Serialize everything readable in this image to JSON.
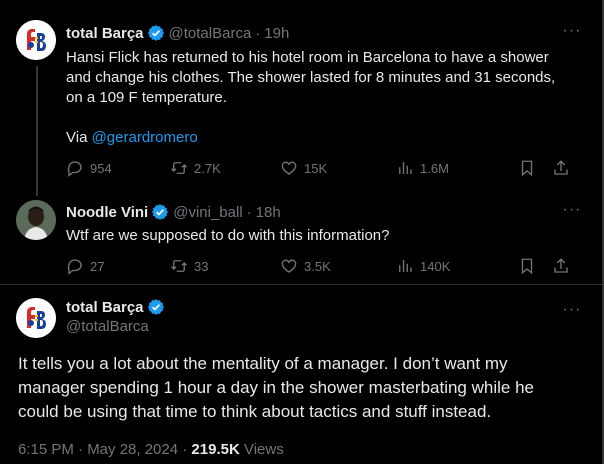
{
  "tweets": [
    {
      "name": "total Barça",
      "handle": "@totalBarca",
      "time": "19h",
      "text_lines": [
        "Hansi Flick has returned to his hotel room in Barcelona to have a shower",
        "and change his clothes. The shower lasted for 8 minutes and 31 seconds,",
        "on a 109 F temperature."
      ],
      "via_prefix": "Via ",
      "via_link": "@gerardromero",
      "replies": "954",
      "retweets": "2.7K",
      "likes": "15K",
      "views": "1.6M",
      "avatar_icon": "total-barca-logo"
    },
    {
      "name": "Noodle Vini",
      "handle": "@vini_ball",
      "time": "18h",
      "text": "Wtf are we supposed to do with this information?",
      "replies": "27",
      "retweets": "33",
      "likes": "3.5K",
      "views": "140K",
      "avatar_icon": "user-photo"
    }
  ],
  "main": {
    "name": "total Barça",
    "handle": "@totalBarca",
    "text_lines": [
      "It tells you a lot about the mentality of a manager. I don’t want my",
      "manager spending 1 hour a day in the shower masterbating while he",
      "could be using that time to think about tactics and stuff instead."
    ],
    "timestamp": "6:15 PM · May 28, 2024 · ",
    "views_count": "219.5K",
    "views_label": " Views",
    "avatar_icon": "total-barca-logo"
  },
  "separator": "·",
  "more_glyph": "···",
  "colors": {
    "background": "#000000",
    "text": "#e7e9ea",
    "muted": "#71767b",
    "link": "#1d9bf0",
    "verified": "#1d9bf0"
  }
}
